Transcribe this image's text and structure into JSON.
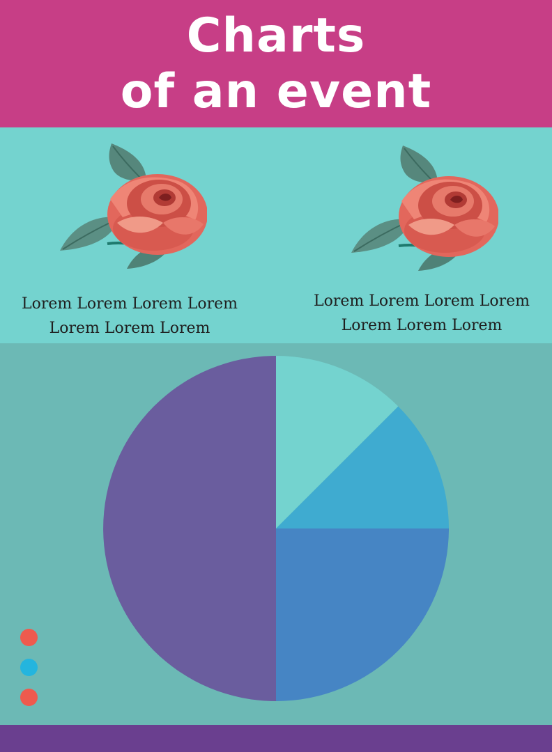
{
  "header": {
    "title_line1": "Charts",
    "title_line2": "of an event",
    "background": "#c73e86"
  },
  "band": {
    "background": "#74d3cf",
    "items": [
      {
        "icon": "rose-icon",
        "caption_line1": "Lorem Lorem Lorem Lorem",
        "caption_line2": "Lorem Lorem Lorem"
      },
      {
        "icon": "rose-icon",
        "caption_line1": "Lorem Lorem Lorem Lorem",
        "caption_line2": "Lorem Lorem Lorem"
      }
    ]
  },
  "chart_data": {
    "type": "pie",
    "title": "",
    "start_angle": "top, clockwise",
    "slices": [
      {
        "value": 12.5,
        "color": "#74d3cf"
      },
      {
        "value": 12.5,
        "color": "#3fabd0"
      },
      {
        "value": 25,
        "color": "#4685c4"
      },
      {
        "value": 50,
        "color": "#6a5d9e"
      }
    ],
    "legend_placement": "bottom-left",
    "legend_markers": [
      {
        "color": "#ee5a4e"
      },
      {
        "color": "#24b5de"
      },
      {
        "color": "#ee5a4e"
      }
    ],
    "background": "#6cb9b5"
  },
  "footer": {
    "background": "#6a3f8f"
  }
}
